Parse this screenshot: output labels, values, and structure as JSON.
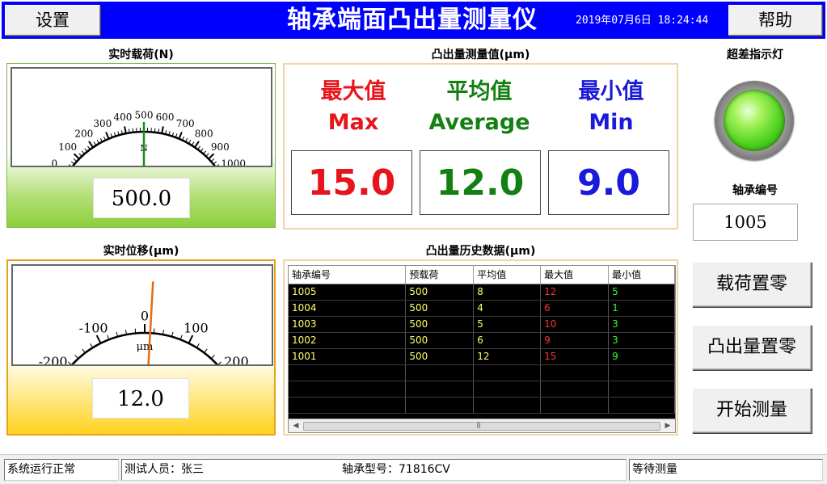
{
  "header": {
    "settings_label": "设置",
    "title": "轴承端面凸出量测量仪",
    "datetime": "2019年07月6日 18:24:44",
    "help_label": "帮助"
  },
  "load_gauge": {
    "title": "实时载荷(N)",
    "ticks": [
      "0",
      "100",
      "200",
      "300",
      "400",
      "500",
      "600",
      "700",
      "800",
      "900",
      "1000"
    ],
    "unit": "N",
    "value": 500.0,
    "display": "500.0",
    "needle_color": "#1a8a1a"
  },
  "disp_gauge": {
    "title": "实时位移(μm)",
    "ticks": [
      "-200",
      "-100",
      "0",
      "100",
      "200"
    ],
    "unit": "μm",
    "value": 12.0,
    "display": "12.0",
    "needle_color": "#e86a10"
  },
  "measure": {
    "title": "凸出量测量值(μm)",
    "max": {
      "zh": "最大值",
      "en": "Max",
      "value": "15.0",
      "color": "#e8141b"
    },
    "avg": {
      "zh": "平均值",
      "en": "Average",
      "value": "12.0",
      "color": "#138013"
    },
    "min": {
      "zh": "最小值",
      "en": "Min",
      "value": "9.0",
      "color": "#1a1ad8"
    }
  },
  "indicator": {
    "title": "超差指示灯",
    "state_color": "#4fd31f"
  },
  "bearing": {
    "title": "轴承编号",
    "value": "1005"
  },
  "buttons": {
    "zero_load": "载荷置零",
    "zero_protrusion": "凸出量置零",
    "start": "开始测量"
  },
  "history": {
    "title": "凸出量历史数据(μm)",
    "columns": [
      "轴承编号",
      "预载荷",
      "平均值",
      "最大值",
      "最小值"
    ],
    "rows": [
      [
        "1005",
        "500",
        "8",
        "12",
        "5"
      ],
      [
        "1004",
        "500",
        "4",
        "6",
        "1"
      ],
      [
        "1003",
        "500",
        "5",
        "10",
        "3"
      ],
      [
        "1002",
        "500",
        "6",
        "9",
        "3"
      ],
      [
        "1001",
        "500",
        "12",
        "15",
        "9"
      ]
    ],
    "empty_rows": 3
  },
  "status": {
    "system": "系统运行正常",
    "operator": "测试人员：张三",
    "model": "轴承型号：71816CV",
    "state": "等待测量"
  }
}
